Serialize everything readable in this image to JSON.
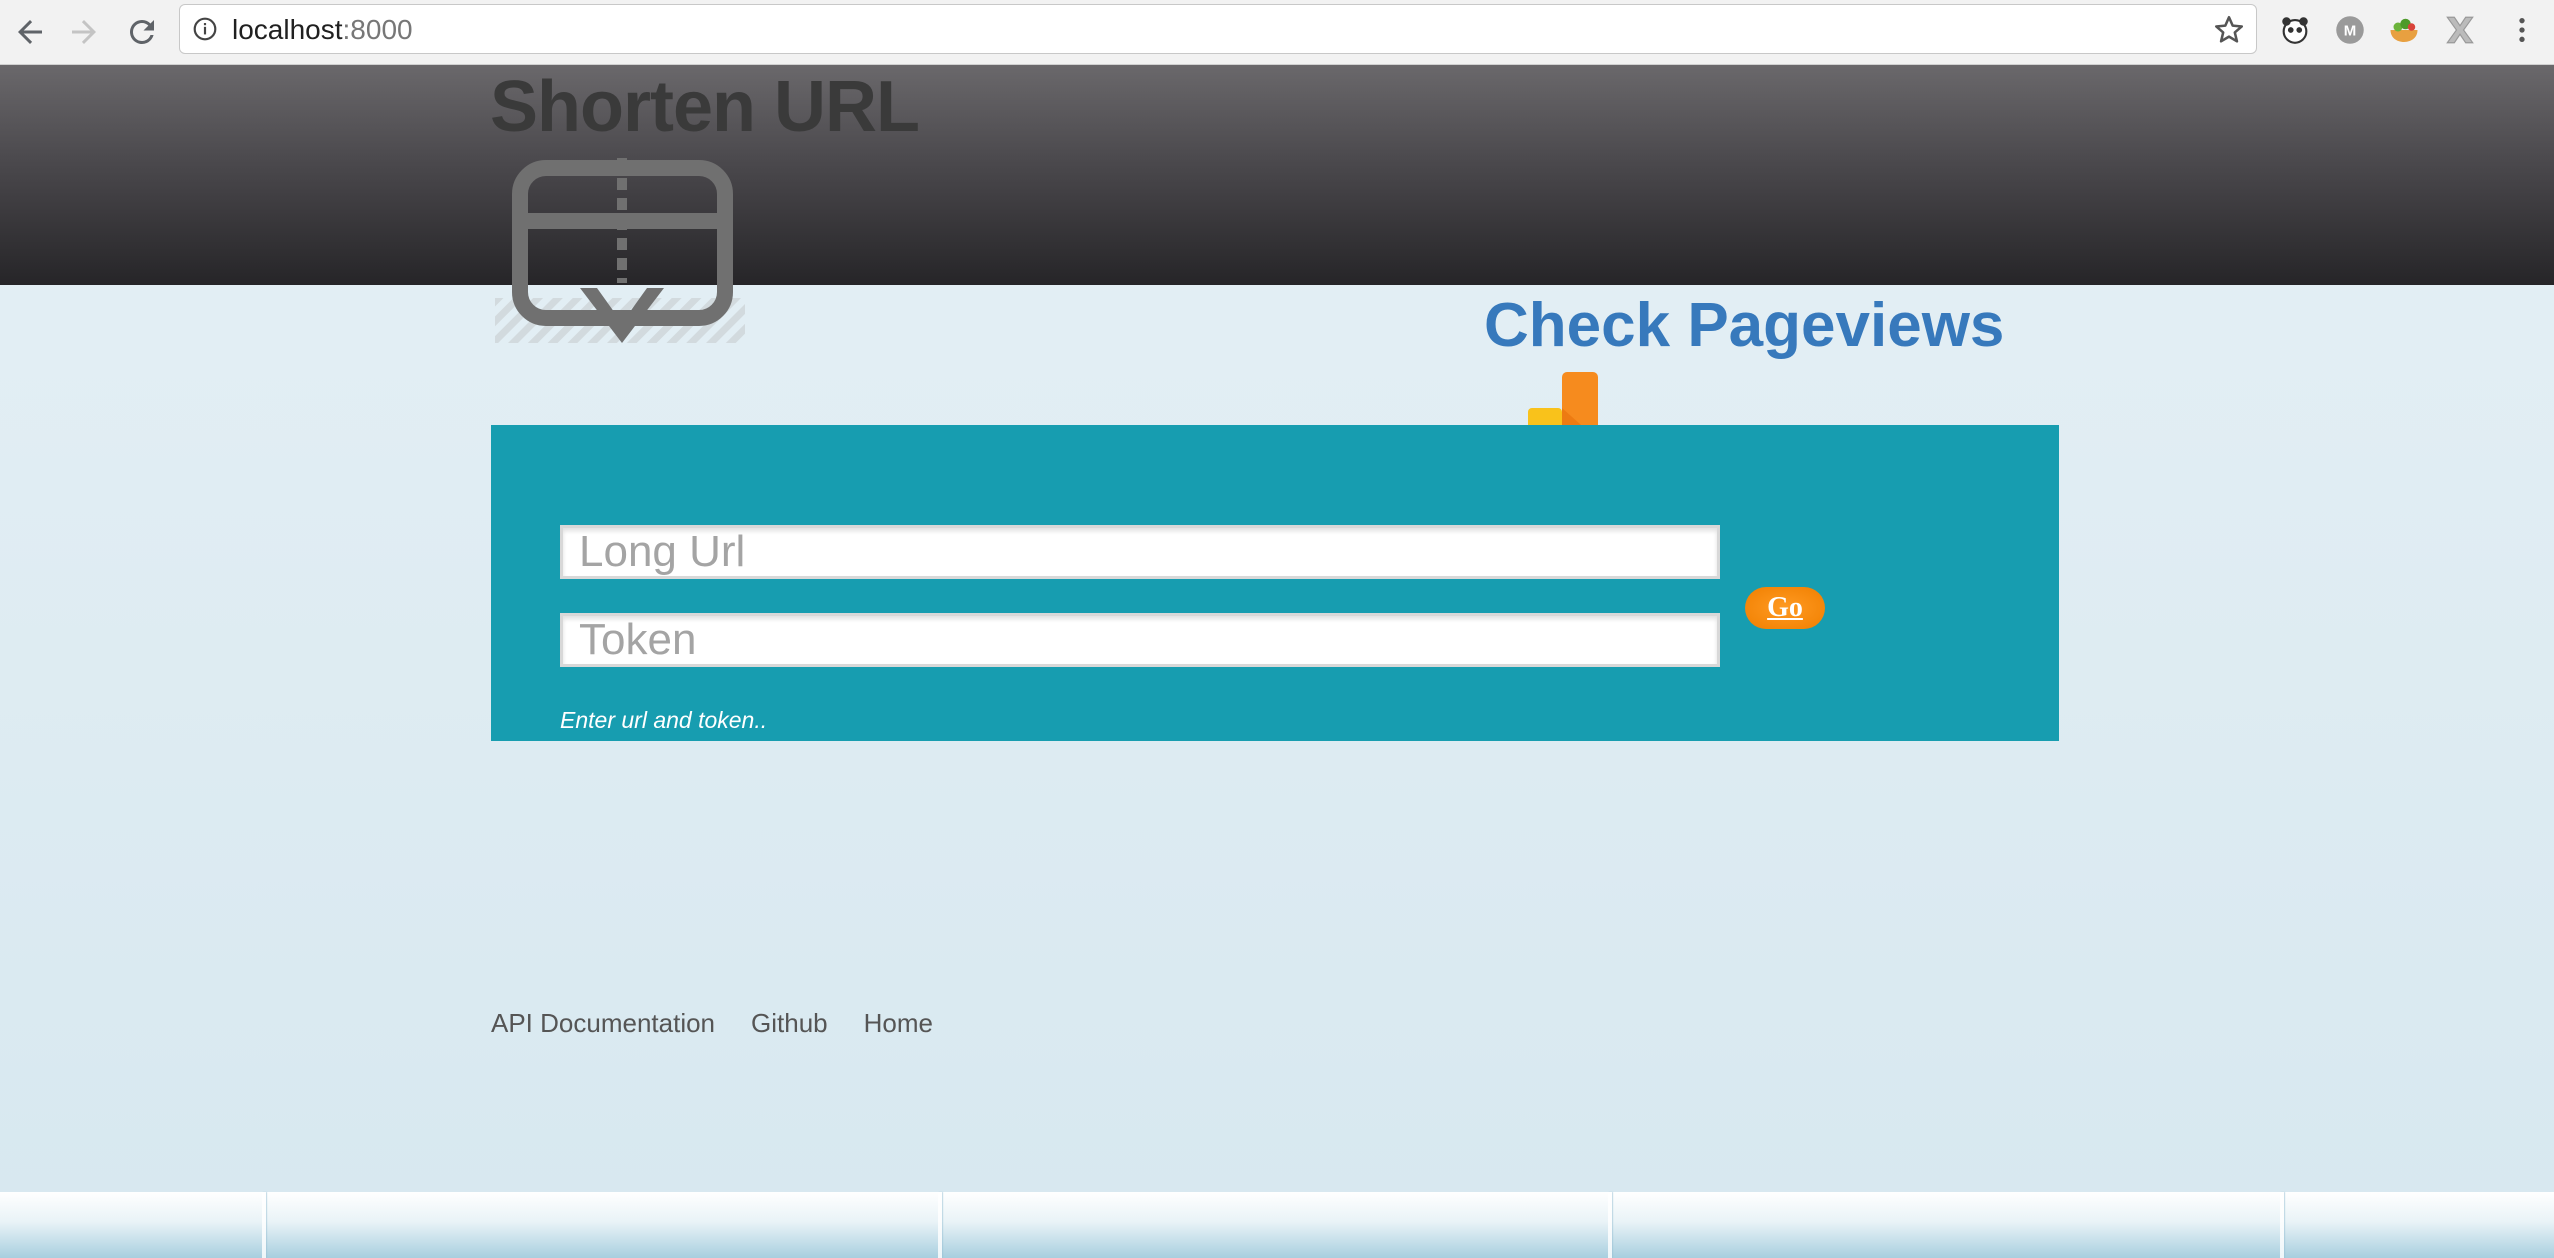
{
  "browser": {
    "url_host": "localhost",
    "url_port": ":8000",
    "extensions": [
      "panda-extension-icon",
      "profile-m-icon",
      "salad-extension-icon",
      "x-extension-icon"
    ],
    "profile_letter": "M"
  },
  "header": {
    "title": "Shorten URL"
  },
  "pageviews": {
    "label": "Check Pageviews"
  },
  "form": {
    "long_url_placeholder": "Long Url",
    "token_placeholder": "Token",
    "submit_label": "Go",
    "status": "Enter url and token.."
  },
  "footer": {
    "links": [
      "API Documentation",
      "Github",
      "Home"
    ]
  },
  "colors": {
    "panel": "#179db0",
    "link": "#3779bc",
    "button": "#f07f00"
  }
}
